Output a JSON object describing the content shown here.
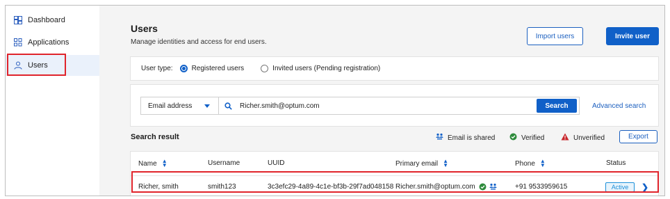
{
  "sidebar": {
    "items": [
      {
        "label": "Dashboard",
        "icon": "dashboard-icon"
      },
      {
        "label": "Applications",
        "icon": "applications-icon"
      },
      {
        "label": "Users",
        "icon": "user-icon",
        "active": true
      }
    ]
  },
  "header": {
    "title": "Users",
    "subtitle": "Manage identities and access for end users.",
    "import_label": "Import users",
    "invite_label": "Invite user"
  },
  "filter": {
    "label": "User type:",
    "options": [
      {
        "label": "Registered users",
        "checked": true
      },
      {
        "label": "Invited users (Pending registration)",
        "checked": false
      }
    ]
  },
  "search": {
    "field": "Email address",
    "query": "Richer.smith@optum.com",
    "button": "Search",
    "advanced": "Advanced search"
  },
  "results": {
    "title": "Search result",
    "legend": {
      "shared": "Email is shared",
      "verified": "Verified",
      "unverified": "Unverified"
    },
    "export_label": "Export",
    "columns": [
      "Name",
      "Username",
      "UUID",
      "Primary email",
      "Phone",
      "Status"
    ],
    "rows": [
      {
        "name": "Richer, smith",
        "username": "smith123",
        "uuid": "3c3efc29-4a89-4c1e-bf3b-29f7ad048158",
        "email": "Richer.smith@optum.com",
        "phone": "+91 9533959615",
        "status": "Active"
      }
    ]
  },
  "colors": {
    "accent": "#1060c8",
    "highlight": "#e0242b",
    "verified": "#2e8b3c",
    "unverified": "#c8262b"
  }
}
